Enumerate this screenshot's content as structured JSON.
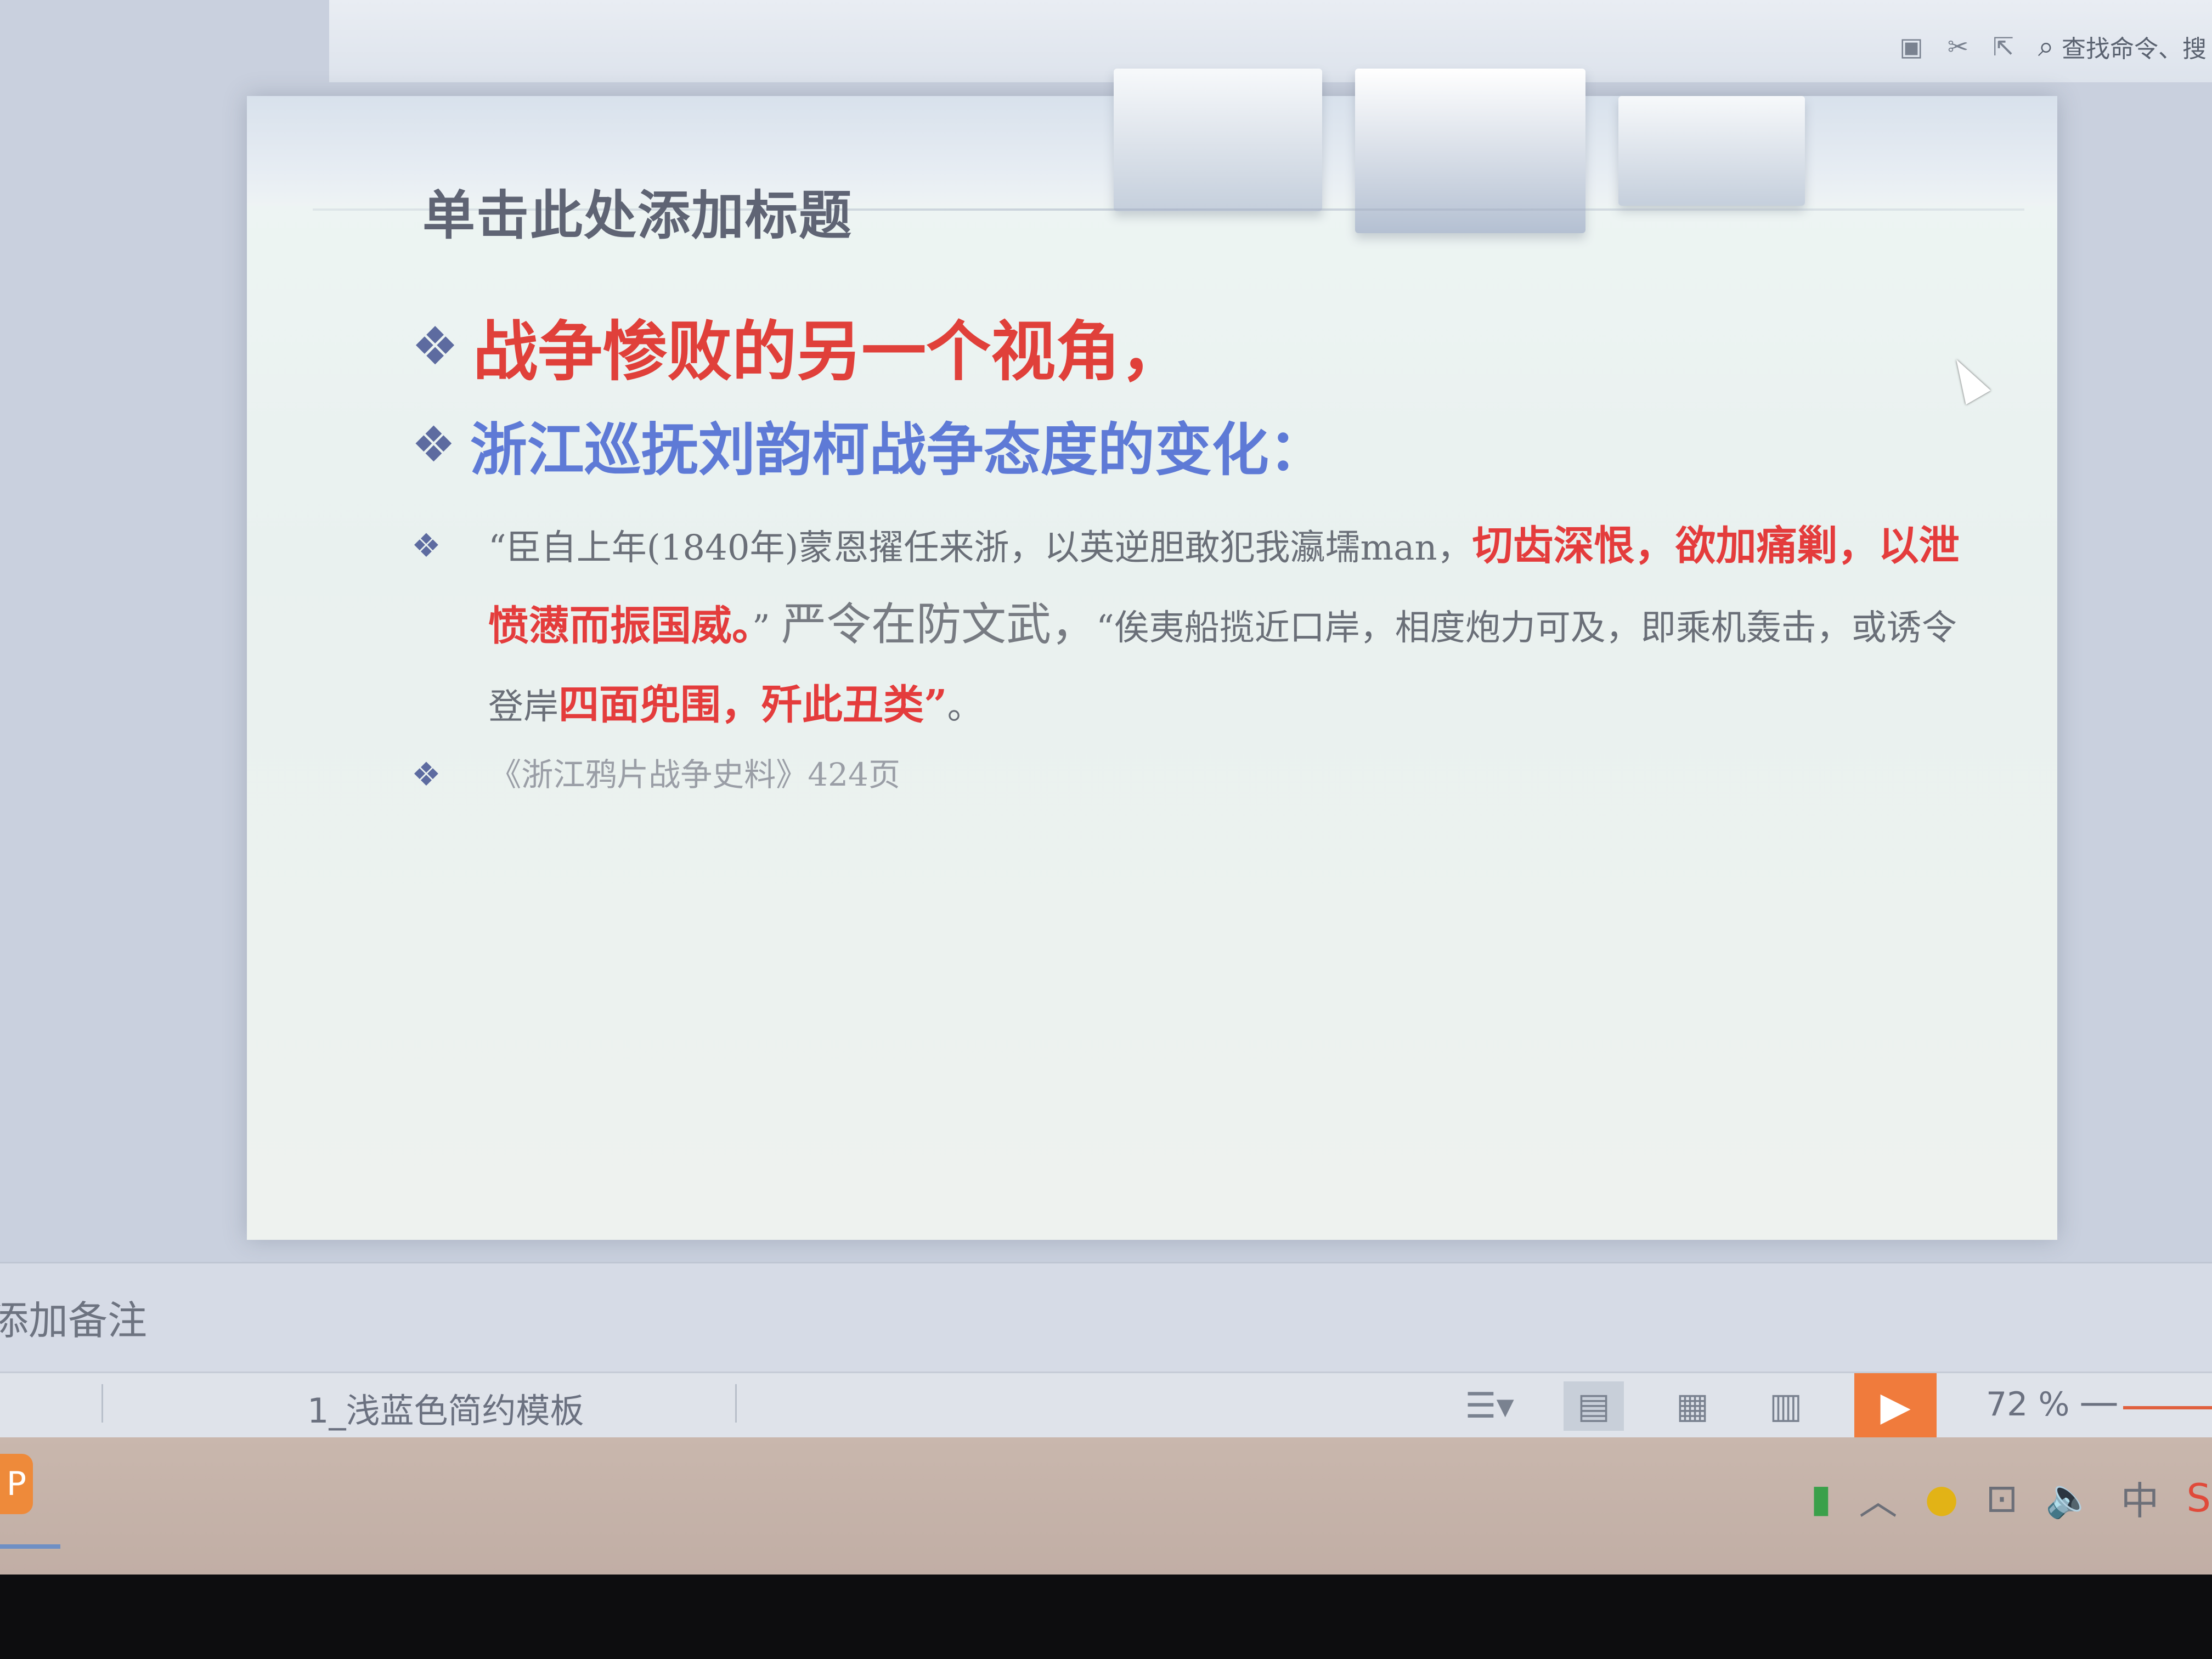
{
  "toolbar": {
    "icons": [
      "slides-icon",
      "scissors-icon",
      "share-icon"
    ],
    "search_icon": "search-icon",
    "search_label": "查找命令、搜"
  },
  "slide": {
    "title": "单击此处添加标题",
    "bullet1": "战争惨败的另一个视角，",
    "bullet2": "浙江巡抚刘韵柯战争态度的变化：",
    "quote": {
      "part1": "“臣自上年(1840年)蒙恩擢任来浙，以英逆胆敢犯我瀛壖man，",
      "part2_red": "切齿深恨，欲加痛剿，以泄愤懑而振国威。",
      "part3": "”",
      "part4_large": "严令在防文武，",
      "part5": "“俟夷船揽近口岸，相度炮力可及，即乘机轰击，或诱令登岸",
      "part6_red": "四面兜围，歼此丑类”",
      "part7": "。"
    },
    "source": "《浙江鸦片战争史料》424页",
    "bullet_symbol": "❖"
  },
  "notes": {
    "placeholder": "添加备注"
  },
  "status_bar": {
    "template_name": "1_浅蓝色简约模板",
    "zoom_level": "72 %",
    "zoom_minus": "—"
  },
  "taskbar": {
    "tray_ime": "中"
  },
  "colors": {
    "accent_red": "#e43c3c",
    "accent_blue": "#5e7ad6",
    "play_orange": "#f07b3c"
  }
}
